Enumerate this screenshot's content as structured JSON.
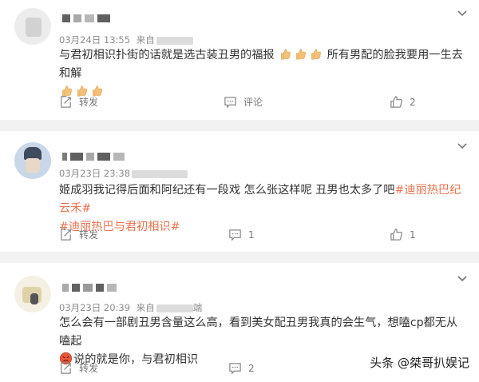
{
  "posts": [
    {
      "meta_date": "03月24日 13:55",
      "meta_from": "来自",
      "text_before": "与君初相识扑街的话就是选古装丑男的福报",
      "text_after": "所有男配的脸我要用一生去和解",
      "actions": {
        "repost": "转发",
        "comment": "评论",
        "like": "2"
      }
    },
    {
      "meta_date": "03月23日 23:38",
      "meta_from": "",
      "text_main": "姬成羽我记得后面和阿纪还有一段戏 怎么张这样呢 丑男也太多了吧",
      "topic1": "#迪丽热巴纪云禾#",
      "topic2": "#迪丽热巴与君初相识#",
      "actions": {
        "repost": "转发",
        "comment": "1",
        "like": "1"
      }
    },
    {
      "meta_date": "03月23日 20:39",
      "meta_from": "来自",
      "meta_end": "端",
      "text_main": "怎么会有一部剧丑男含量这么高，看到美女配丑男我真的会生气，想嗑cp都无从嗑起",
      "text_tail": "说的就是你，与君初相识",
      "actions": {
        "repost": "转发",
        "comment": "2",
        "like": ""
      }
    }
  ],
  "watermark": "头条 @桀哥扒娱记",
  "colors": {
    "topic": "#eb7350",
    "separator": "#f2f2f2"
  },
  "icons": [
    "chevron-down-icon",
    "repost-icon",
    "comment-icon",
    "like-icon",
    "thumbs-up-emoji",
    "angry-emoji"
  ]
}
